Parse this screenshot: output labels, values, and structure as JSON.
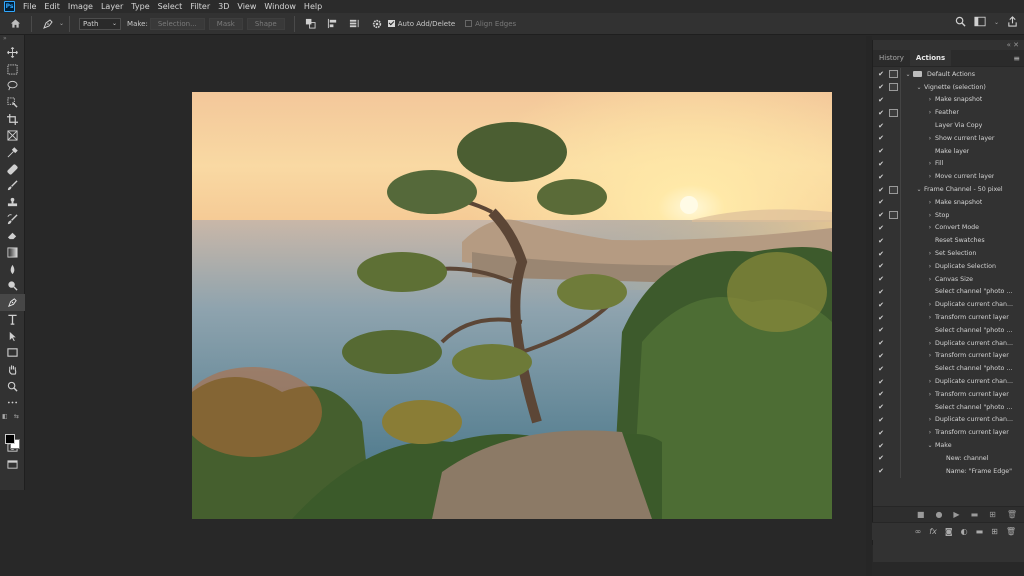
{
  "app": {
    "logo": "Ps"
  },
  "menu": [
    "File",
    "Edit",
    "Image",
    "Layer",
    "Type",
    "Select",
    "Filter",
    "3D",
    "View",
    "Window",
    "Help"
  ],
  "options": {
    "mode_value": "Path",
    "make_label": "Make:",
    "selection_label": "Selection...",
    "mask_label": "Mask",
    "shape_label": "Shape",
    "auto_add_delete_label": "Auto Add/Delete",
    "auto_add_delete_checked": true,
    "align_edges_label": "Align Edges",
    "align_edges_checked": false
  },
  "panel": {
    "tabs": [
      "History",
      "Actions"
    ],
    "active_tab": "Actions"
  },
  "actions": [
    {
      "indent": 0,
      "arrow": "open",
      "folder": true,
      "label": "Default Actions",
      "dialog": true
    },
    {
      "indent": 1,
      "arrow": "open",
      "folder": false,
      "label": "Vignette (selection)",
      "dialog": true
    },
    {
      "indent": 2,
      "arrow": "closed",
      "label": "Make snapshot",
      "dialog": false
    },
    {
      "indent": 2,
      "arrow": "closed",
      "label": "Feather",
      "dialog": true
    },
    {
      "indent": 2,
      "arrow": "none",
      "label": "Layer Via Copy",
      "dialog": false
    },
    {
      "indent": 2,
      "arrow": "closed",
      "label": "Show current layer",
      "dialog": false
    },
    {
      "indent": 2,
      "arrow": "none",
      "label": "Make layer",
      "dialog": false
    },
    {
      "indent": 2,
      "arrow": "closed",
      "label": "Fill",
      "dialog": false
    },
    {
      "indent": 2,
      "arrow": "closed",
      "label": "Move current layer",
      "dialog": false
    },
    {
      "indent": 1,
      "arrow": "open",
      "folder": false,
      "label": "Frame Channel - 50 pixel",
      "dialog": true
    },
    {
      "indent": 2,
      "arrow": "closed",
      "label": "Make snapshot",
      "dialog": false
    },
    {
      "indent": 2,
      "arrow": "closed",
      "label": "Stop",
      "dialog": true
    },
    {
      "indent": 2,
      "arrow": "closed",
      "label": "Convert Mode",
      "dialog": false
    },
    {
      "indent": 2,
      "arrow": "none",
      "label": "Reset Swatches",
      "dialog": false
    },
    {
      "indent": 2,
      "arrow": "closed",
      "label": "Set Selection",
      "dialog": false
    },
    {
      "indent": 2,
      "arrow": "closed",
      "label": "Duplicate Selection",
      "dialog": false
    },
    {
      "indent": 2,
      "arrow": "closed",
      "label": "Canvas Size",
      "dialog": false
    },
    {
      "indent": 2,
      "arrow": "none",
      "label": "Select channel \"photo ...",
      "dialog": false
    },
    {
      "indent": 2,
      "arrow": "closed",
      "label": "Duplicate current chan...",
      "dialog": false
    },
    {
      "indent": 2,
      "arrow": "closed",
      "label": "Transform current layer",
      "dialog": false
    },
    {
      "indent": 2,
      "arrow": "none",
      "label": "Select channel \"photo ...",
      "dialog": false
    },
    {
      "indent": 2,
      "arrow": "closed",
      "label": "Duplicate current chan...",
      "dialog": false
    },
    {
      "indent": 2,
      "arrow": "closed",
      "label": "Transform current layer",
      "dialog": false
    },
    {
      "indent": 2,
      "arrow": "none",
      "label": "Select channel \"photo ...",
      "dialog": false
    },
    {
      "indent": 2,
      "arrow": "closed",
      "label": "Duplicate current chan...",
      "dialog": false
    },
    {
      "indent": 2,
      "arrow": "closed",
      "label": "Transform current layer",
      "dialog": false
    },
    {
      "indent": 2,
      "arrow": "none",
      "label": "Select channel \"photo ...",
      "dialog": false
    },
    {
      "indent": 2,
      "arrow": "closed",
      "label": "Duplicate current chan...",
      "dialog": false
    },
    {
      "indent": 2,
      "arrow": "closed",
      "label": "Transform current layer",
      "dialog": false
    },
    {
      "indent": 2,
      "arrow": "open",
      "label": "Make",
      "dialog": false
    },
    {
      "indent": 3,
      "arrow": "none",
      "label": "New: channel",
      "dialog": false
    },
    {
      "indent": 3,
      "arrow": "none",
      "label": "Name: \"Frame Edge\"",
      "dialog": false
    }
  ],
  "colors": {
    "foreground": "#000000",
    "background": "#ffffff",
    "accent": "#31a8ff"
  }
}
